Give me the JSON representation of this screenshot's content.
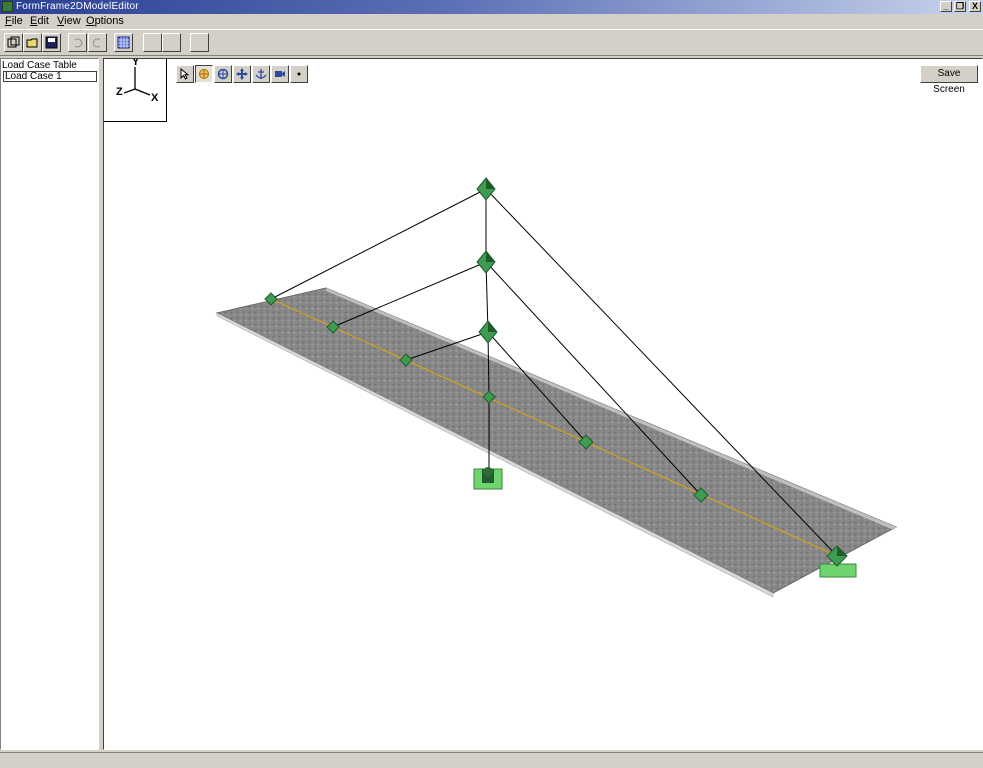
{
  "window": {
    "title": "FormFrame2DModelEditor",
    "minimize_glyph": "_",
    "restore_glyph": "❐",
    "close_glyph": "X",
    "title_gradient_start": "#2a3f93"
  },
  "menu": {
    "items": [
      "File",
      "Edit",
      "View",
      "Options"
    ]
  },
  "toolbar": {
    "buttons": [
      "new-model-icon",
      "open-folder-icon",
      "save-disk-icon",
      "undo-icon",
      "redo-icon",
      "grid-icon",
      "blank-icon",
      "blank-icon",
      "blank-icon"
    ]
  },
  "sidebar": {
    "header": "Load Case Table",
    "rows": [
      "Load Case 1"
    ]
  },
  "viewport": {
    "axes": {
      "y": "Y",
      "z": "Z",
      "x": "X"
    },
    "tools": [
      "select-arrow-icon",
      "pan-hand-icon",
      "rotate-icon",
      "move-icon",
      "anchor-icon",
      "camera-icon",
      "dot-icon"
    ],
    "save_button": "Save Screen",
    "colors": {
      "deck": "#8a8a8a",
      "deck_edge": "#c9c9c9",
      "node": "#3f9a52",
      "node_dark": "#1f5c2c",
      "support": "#6fd36f",
      "cable": "#000000",
      "centerline": "#d6a019"
    }
  }
}
